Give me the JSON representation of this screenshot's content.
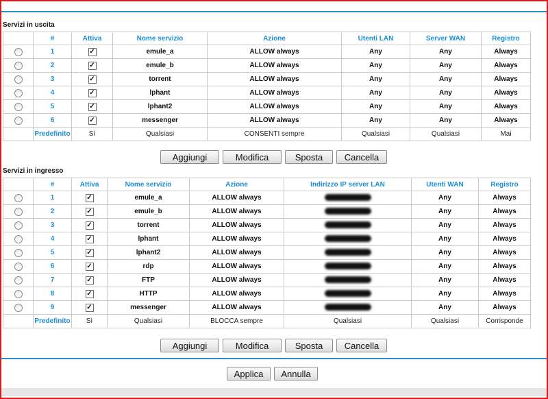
{
  "outgoing": {
    "title": "Servizi in uscita",
    "headers": [
      "#",
      "Attiva",
      "Nome servizio",
      "Azione",
      "Utenti LAN",
      "Server WAN",
      "Registro"
    ],
    "rows": [
      {
        "num": "1",
        "service": "emule_a",
        "action": "ALLOW always",
        "lan": "Any",
        "wan": "Any",
        "log": "Always",
        "checked": true
      },
      {
        "num": "2",
        "service": "emule_b",
        "action": "ALLOW always",
        "lan": "Any",
        "wan": "Any",
        "log": "Always",
        "checked": true
      },
      {
        "num": "3",
        "service": "torrent",
        "action": "ALLOW always",
        "lan": "Any",
        "wan": "Any",
        "log": "Always",
        "checked": true
      },
      {
        "num": "4",
        "service": "lphant",
        "action": "ALLOW always",
        "lan": "Any",
        "wan": "Any",
        "log": "Always",
        "checked": true
      },
      {
        "num": "5",
        "service": "lphant2",
        "action": "ALLOW always",
        "lan": "Any",
        "wan": "Any",
        "log": "Always",
        "checked": true
      },
      {
        "num": "6",
        "service": "messenger",
        "action": "ALLOW always",
        "lan": "Any",
        "wan": "Any",
        "log": "Always",
        "checked": true
      }
    ],
    "default": {
      "label": "Predefinito",
      "active": "Sì",
      "service": "Qualsiasi",
      "action": "CONSENTI sempre",
      "lan": "Qualsiasi",
      "wan": "Qualsiasi",
      "log": "Mai"
    }
  },
  "incoming": {
    "title": "Servizi in ingresso",
    "headers": [
      "#",
      "Attiva",
      "Nome servizio",
      "Azione",
      "Indirizzo IP server LAN",
      "Utenti WAN",
      "Registro"
    ],
    "rows": [
      {
        "num": "1",
        "service": "emule_a",
        "action": "ALLOW always",
        "wan": "Any",
        "log": "Always",
        "checked": true
      },
      {
        "num": "2",
        "service": "emule_b",
        "action": "ALLOW always",
        "wan": "Any",
        "log": "Always",
        "checked": true
      },
      {
        "num": "3",
        "service": "torrent",
        "action": "ALLOW always",
        "wan": "Any",
        "log": "Always",
        "checked": true
      },
      {
        "num": "4",
        "service": "lphant",
        "action": "ALLOW always",
        "wan": "Any",
        "log": "Always",
        "checked": true
      },
      {
        "num": "5",
        "service": "lphant2",
        "action": "ALLOW always",
        "wan": "Any",
        "log": "Always",
        "checked": true
      },
      {
        "num": "6",
        "service": "rdp",
        "action": "ALLOW always",
        "wan": "Any",
        "log": "Always",
        "checked": true
      },
      {
        "num": "7",
        "service": "FTP",
        "action": "ALLOW always",
        "wan": "Any",
        "log": "Always",
        "checked": true
      },
      {
        "num": "8",
        "service": "HTTP",
        "action": "ALLOW always",
        "wan": "Any",
        "log": "Always",
        "checked": true
      },
      {
        "num": "9",
        "service": "messenger",
        "action": "ALLOW always",
        "wan": "Any",
        "log": "Always",
        "checked": true
      }
    ],
    "default": {
      "label": "Predefinito",
      "active": "Sì",
      "service": "Qualsiasi",
      "action": "BLOCCA sempre",
      "ip": "Qualsiasi",
      "wan": "Qualsiasi",
      "log": "Corrisponde"
    }
  },
  "buttons": {
    "add": "Aggiungi",
    "edit": "Modifica",
    "move": "Sposta",
    "delete": "Cancella"
  },
  "footer": {
    "apply": "Applica",
    "cancel": "Annulla"
  },
  "colors": {
    "accent": "#1a8fd6",
    "frame": "#d81c1c",
    "separator": "#2e8fc4"
  }
}
